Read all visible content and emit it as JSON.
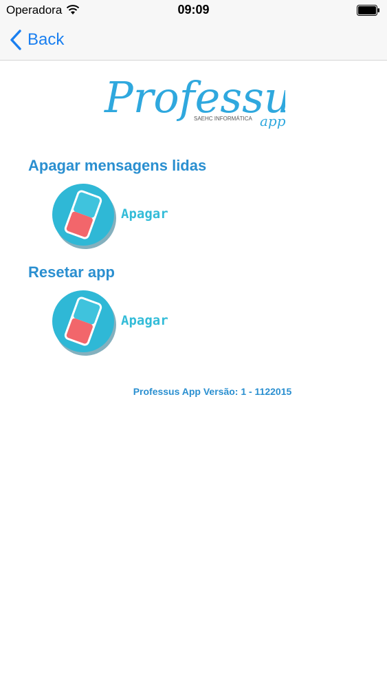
{
  "status_bar": {
    "carrier": "Operadora",
    "time": "09:09"
  },
  "nav": {
    "back_label": "Back"
  },
  "logo": {
    "name": "Professus",
    "suffix": "app",
    "tagline": "SAEHC INFORMÁTICA"
  },
  "sections": [
    {
      "title": "Apagar mensagens lidas",
      "button_label": "Apagar",
      "icon": "eraser-icon"
    },
    {
      "title": "Resetar app",
      "button_label": "Apagar",
      "icon": "eraser-icon"
    }
  ],
  "footer": {
    "version_text": "Professus App Versão: 1 - 1122015"
  },
  "colors": {
    "accent": "#2a8fd0",
    "ios_blue": "#1a7ff0",
    "eraser_circle": "#2fb8d6",
    "eraser_red": "#f2666b",
    "button_text": "#33bcd8"
  }
}
